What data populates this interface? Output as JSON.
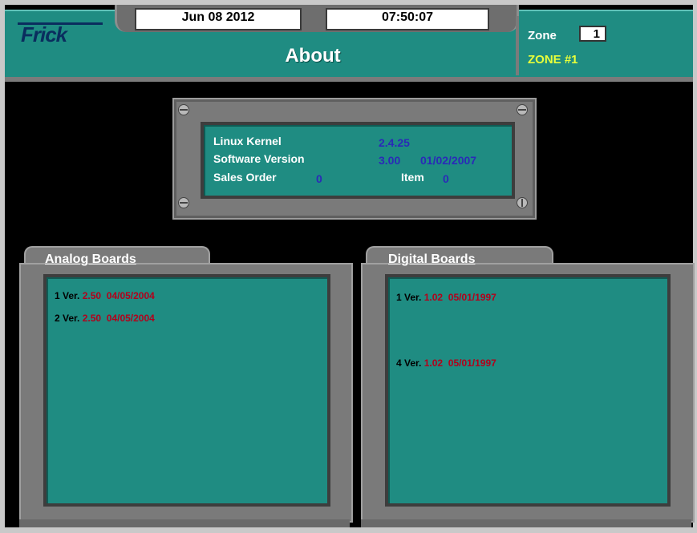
{
  "header": {
    "logo": "Frick",
    "date": "Jun 08 2012",
    "time": "07:50:07",
    "title": "About",
    "zone_label": "Zone",
    "zone_number": "1",
    "zone_name": "ZONE #1"
  },
  "about": {
    "linux_kernel_label": "Linux Kernel",
    "linux_kernel_value": "2.4.25",
    "software_version_label": "Software Version",
    "software_version_value": "3.00",
    "software_version_date": "01/02/2007",
    "sales_order_label": "Sales Order",
    "sales_order_value": "0",
    "item_label": "Item",
    "item_value": "0"
  },
  "analog_boards": {
    "title": "Analog Boards",
    "boards": [
      {
        "index": "1",
        "ver_label": "Ver.",
        "version": "2.50",
        "date": "04/05/2004"
      },
      {
        "index": "2",
        "ver_label": "Ver.",
        "version": "2.50",
        "date": "04/05/2004"
      }
    ]
  },
  "digital_boards": {
    "title": "Digital Boards",
    "boards": [
      {
        "index": "1",
        "ver_label": "Ver.",
        "version": "1.02",
        "date": "05/01/1997"
      },
      {
        "index": "4",
        "ver_label": "Ver.",
        "version": "1.02",
        "date": "05/01/1997"
      }
    ]
  },
  "colors": {
    "panel_teal": "#1f8c82",
    "value_blue": "#2a2ab8",
    "value_red": "#b3001b",
    "zone_yellow": "#e8ff3a"
  }
}
